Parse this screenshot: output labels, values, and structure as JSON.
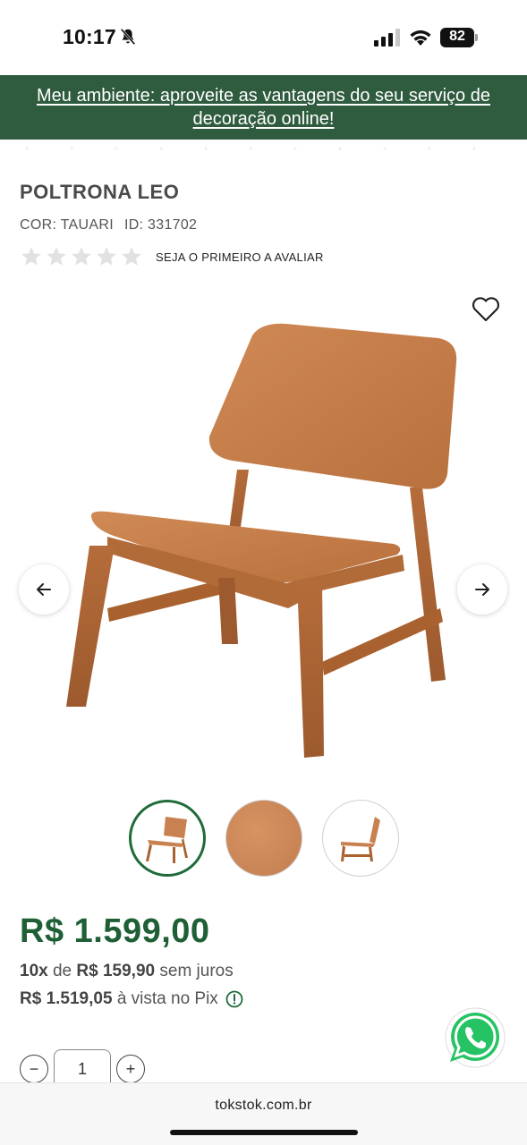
{
  "status_bar": {
    "time": "10:17",
    "battery": "82",
    "icons": [
      "bell-off-icon",
      "cellular-signal-icon",
      "wifi-icon",
      "battery-icon"
    ]
  },
  "banner": {
    "text": "Meu ambiente: aproveite as vantagens do seu serviço de decoração online!",
    "background": "#2f5b3f"
  },
  "product": {
    "title": "POLTRONA LEO",
    "color_label": "COR: TAUARI",
    "id_label": "ID: 331702",
    "rating_cta": "SEJA O PRIMEIRO A AVALIAR",
    "stars_filled": 0,
    "stars_total": 5
  },
  "gallery": {
    "thumbnail_count": 3,
    "active_index": 0,
    "icons": [
      "heart-icon",
      "arrow-left-icon",
      "arrow-right-icon"
    ]
  },
  "pricing": {
    "price": "R$ 1.599,00",
    "installments_count": "10x",
    "installments_de": "de",
    "installment_value": "R$ 159,90",
    "installments_suffix": "sem juros",
    "pix_value": "R$ 1.519,05",
    "pix_suffix": "à vista no Pix",
    "accent": "#1f5f36"
  },
  "quantity": {
    "value": "1",
    "minus": "−",
    "plus": "+"
  },
  "browser": {
    "url": "tokstok.com.br"
  }
}
